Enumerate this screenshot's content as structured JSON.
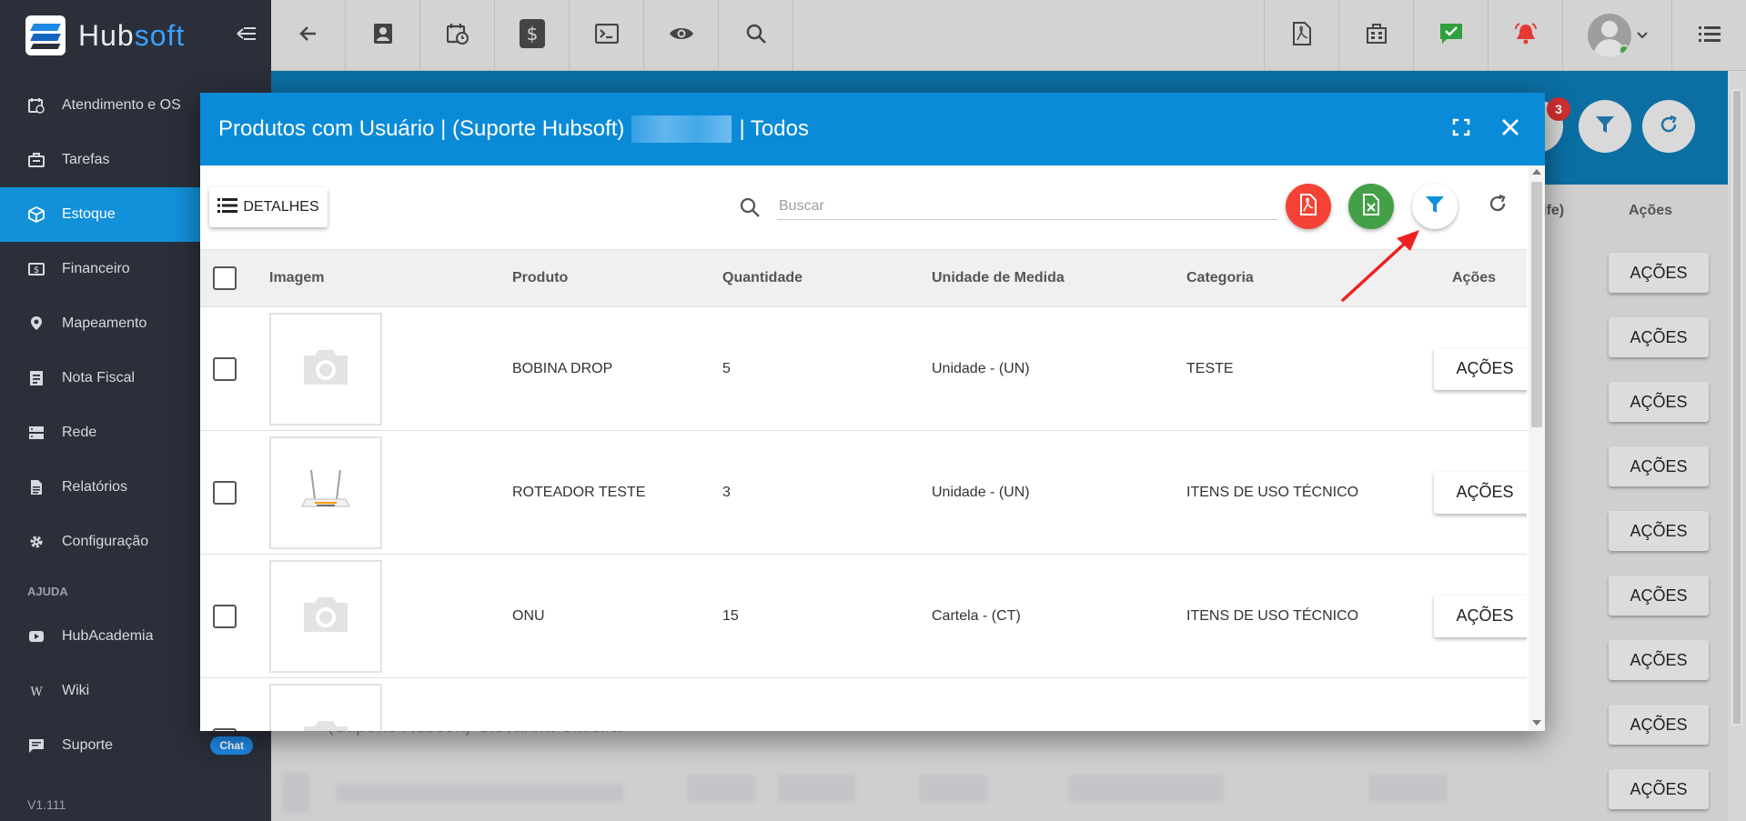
{
  "brand": {
    "name_part1": "Hub",
    "name_part2": "soft"
  },
  "sidebar": {
    "items": [
      {
        "label": "Atendimento e OS",
        "icon": "calendar-clock-icon"
      },
      {
        "label": "Tarefas",
        "icon": "briefcase-icon"
      },
      {
        "label": "Estoque",
        "icon": "box-icon",
        "active": true
      },
      {
        "label": "Financeiro",
        "icon": "money-icon"
      },
      {
        "label": "Mapeamento",
        "icon": "map-pin-icon"
      },
      {
        "label": "Nota Fiscal",
        "icon": "receipt-icon"
      },
      {
        "label": "Rede",
        "icon": "server-icon"
      },
      {
        "label": "Relatórios",
        "icon": "document-icon"
      },
      {
        "label": "Configuração",
        "icon": "gear-icon"
      }
    ],
    "help_section": "AJUDA",
    "help_items": [
      {
        "label": "HubAcademia",
        "icon": "youtube-icon"
      },
      {
        "label": "Wiki",
        "icon": "wiki-icon"
      },
      {
        "label": "Suporte",
        "icon": "chat-icon",
        "badge": "Chat"
      }
    ],
    "version": "V1.111"
  },
  "background": {
    "notification_count": "3",
    "col_tarife": "arife)",
    "col_acoes": "Ações",
    "action_label": "AÇÕES",
    "row_text": "(Suporte Hubsoft) Giovanna Oliveira"
  },
  "modal": {
    "title_part1": "Produtos com Usuário | (Suporte Hubsoft)",
    "title_part2": "| Todos",
    "details_label": "DETALHES",
    "search_placeholder": "Buscar",
    "columns": [
      "Imagem",
      "Produto",
      "Quantidade",
      "Unidade de Medida",
      "Categoria",
      "Ações"
    ],
    "rows": [
      {
        "produto": "BOBINA DROP",
        "quantidade": "5",
        "unidade": "Unidade - (UN)",
        "categoria": "TESTE",
        "acao": "AÇÕES",
        "image": "camera-placeholder-icon"
      },
      {
        "produto": "ROTEADOR TESTE",
        "quantidade": "3",
        "unidade": "Unidade - (UN)",
        "categoria": "ITENS DE USO TÉCNICO",
        "acao": "AÇÕES",
        "image": "router-image"
      },
      {
        "produto": "ONU",
        "quantidade": "15",
        "unidade": "Cartela - (CT)",
        "categoria": "ITENS DE USO TÉCNICO",
        "acao": "AÇÕES",
        "image": "camera-placeholder-icon"
      }
    ]
  },
  "colors": {
    "primary": "#0a8bd8",
    "sidebar_bg": "#2b2f3a",
    "active": "#1291d9",
    "pdf": "#f44336",
    "excel": "#43a047",
    "annotation_arrow": "#ee2222"
  }
}
